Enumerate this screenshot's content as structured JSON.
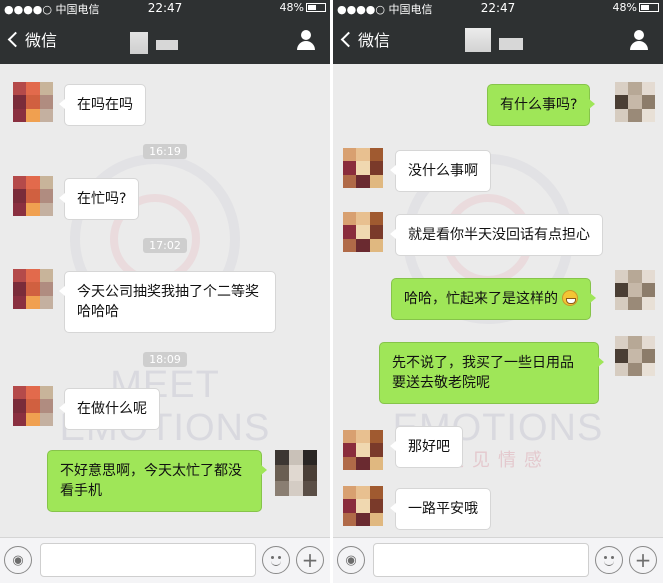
{
  "left_phone": {
    "status": {
      "carrier": "●●●●○ 中国电信",
      "time": "22:47",
      "battery": "48%"
    },
    "nav": {
      "back_label": "微信"
    },
    "messages": [
      {
        "id": "l1",
        "text": "在吗在吗"
      },
      {
        "id": "t1",
        "text": "16:19"
      },
      {
        "id": "l2",
        "text": "在忙吗?"
      },
      {
        "id": "t2",
        "text": "17:02"
      },
      {
        "id": "l3",
        "text": "今天公司抽奖我抽了个二等奖 哈哈哈"
      },
      {
        "id": "t3",
        "text": "18:09"
      },
      {
        "id": "l4",
        "text": "在做什么呢"
      },
      {
        "id": "l5",
        "text": "不好意思啊，今天太忙了都没 看手机"
      }
    ]
  },
  "right_phone": {
    "status": {
      "carrier": "●●●●○ 中国电信",
      "time": "22:47",
      "battery": "48%"
    },
    "nav": {
      "back_label": "微信"
    },
    "messages": [
      {
        "id": "r1",
        "text": "有什么事吗?"
      },
      {
        "id": "r2",
        "text": "没什么事啊"
      },
      {
        "id": "r3",
        "text": "就是看你半天没回话有点担心"
      },
      {
        "id": "r4",
        "text": "哈哈，忙起来了是这样的"
      },
      {
        "id": "r5",
        "text": "先不说了，我买了一些日用品 要送去敬老院呢"
      },
      {
        "id": "r6",
        "text": "那好吧"
      },
      {
        "id": "r7",
        "text": "一路平安哦"
      }
    ]
  },
  "watermark": {
    "en": "MEET EMOTIONS",
    "cn": "遇见情感"
  },
  "icons": {
    "back": "chevron-left-icon",
    "profile": "person-icon",
    "voice": "voice-icon",
    "emoji": "emoji-icon",
    "plus": "plus-icon",
    "grin": "grin-emoji-icon"
  },
  "colors": {
    "nav_bg": "#2e3132",
    "chat_bg": "#ebebeb",
    "outgoing_bubble": "#9fe658",
    "incoming_bubble": "#ffffff"
  }
}
